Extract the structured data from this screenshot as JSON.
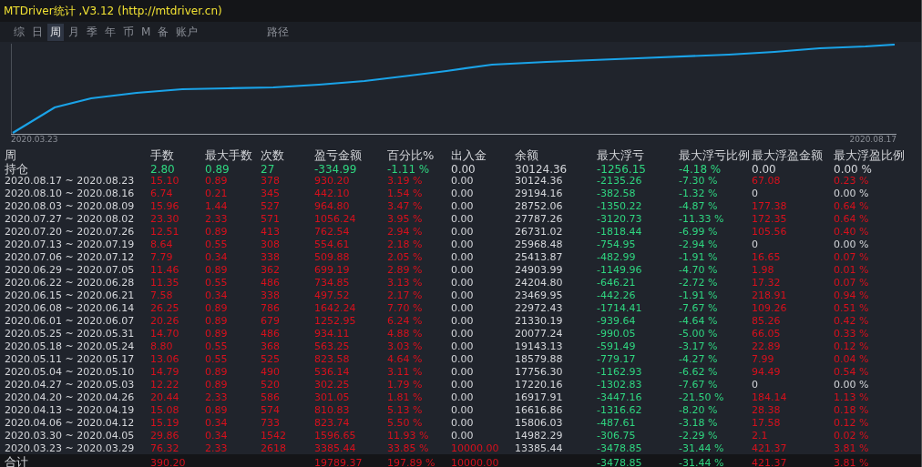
{
  "window": {
    "title": "MTDriver统计 ,V3.12 (http://mtdriver.cn)"
  },
  "tabs": [
    {
      "label": "综",
      "selected": false
    },
    {
      "label": "日",
      "selected": false
    },
    {
      "label": "周",
      "selected": true
    },
    {
      "label": "月",
      "selected": false
    },
    {
      "label": "季",
      "selected": false
    },
    {
      "label": "年",
      "selected": false
    },
    {
      "label": "币",
      "selected": false
    },
    {
      "label": "M",
      "selected": false
    },
    {
      "label": "备",
      "selected": false
    },
    {
      "label": "账户",
      "selected": false
    }
  ],
  "path_button": "路径",
  "chart": {
    "start_label": "2020.03.23",
    "end_label": "2020.08.17"
  },
  "table": {
    "columns": [
      "周",
      "手数",
      "最大手数",
      "次数",
      "盈亏金额",
      "百分比%",
      "出入金",
      "余额",
      "最大浮亏",
      "最大浮亏比例",
      "最大浮盈金额",
      "最大浮盈比例"
    ],
    "rows": [
      {
        "kind": "hold",
        "cells": [
          "持仓",
          {
            "text": "2.80",
            "color": "#2fd680"
          },
          {
            "text": "0.89",
            "color": "#2fd680"
          },
          {
            "text": "27",
            "color": "#2fd680"
          },
          {
            "text": "-334.99",
            "color": "#2fd680"
          },
          {
            "text": "-1.11 %",
            "color": "#2fd680"
          },
          "0.00",
          "30124.36",
          {
            "text": "-1256.15",
            "color": "#2fd680"
          },
          {
            "text": "-4.18 %",
            "color": "#2fd680"
          },
          "0.00",
          "0.00 %"
        ]
      },
      {
        "kind": "week",
        "cells": [
          "2020.08.17 ~ 2020.08.23",
          {
            "text": "15.10",
            "color": "#d8101c"
          },
          {
            "text": "0.89",
            "color": "#d8101c"
          },
          {
            "text": "378",
            "color": "#d8101c"
          },
          {
            "text": "930.20",
            "color": "#d8101c"
          },
          {
            "text": "3.19 %",
            "color": "#d8101c"
          },
          "0.00",
          "30124.36",
          {
            "text": "-2135.26",
            "color": "#2fd680"
          },
          {
            "text": "-7.30 %",
            "color": "#2fd680"
          },
          {
            "text": "67.08",
            "color": "#d8101c"
          },
          {
            "text": "0.23 %",
            "color": "#d8101c"
          }
        ]
      },
      {
        "kind": "week",
        "cells": [
          "2020.08.10 ~ 2020.08.16",
          {
            "text": "6.74",
            "color": "#d8101c"
          },
          {
            "text": "0.21",
            "color": "#d8101c"
          },
          {
            "text": "345",
            "color": "#d8101c"
          },
          {
            "text": "442.10",
            "color": "#d8101c"
          },
          {
            "text": "1.54 %",
            "color": "#d8101c"
          },
          "0.00",
          "29194.16",
          {
            "text": "-382.58",
            "color": "#2fd680"
          },
          {
            "text": "-1.32 %",
            "color": "#2fd680"
          },
          "0",
          "0.00 %"
        ]
      },
      {
        "kind": "week",
        "cells": [
          "2020.08.03 ~ 2020.08.09",
          {
            "text": "15.96",
            "color": "#d8101c"
          },
          {
            "text": "1.44",
            "color": "#d8101c"
          },
          {
            "text": "527",
            "color": "#d8101c"
          },
          {
            "text": "964.80",
            "color": "#d8101c"
          },
          {
            "text": "3.47 %",
            "color": "#d8101c"
          },
          "0.00",
          "28752.06",
          {
            "text": "-1350.22",
            "color": "#2fd680"
          },
          {
            "text": "-4.87 %",
            "color": "#2fd680"
          },
          {
            "text": "177.38",
            "color": "#d8101c"
          },
          {
            "text": "0.64 %",
            "color": "#d8101c"
          }
        ]
      },
      {
        "kind": "week",
        "cells": [
          "2020.07.27 ~ 2020.08.02",
          {
            "text": "23.30",
            "color": "#d8101c"
          },
          {
            "text": "2.33",
            "color": "#d8101c"
          },
          {
            "text": "571",
            "color": "#d8101c"
          },
          {
            "text": "1056.24",
            "color": "#d8101c"
          },
          {
            "text": "3.95 %",
            "color": "#d8101c"
          },
          "0.00",
          "27787.26",
          {
            "text": "-3120.73",
            "color": "#2fd680"
          },
          {
            "text": "-11.33 %",
            "color": "#2fd680"
          },
          {
            "text": "172.35",
            "color": "#d8101c"
          },
          {
            "text": "0.64 %",
            "color": "#d8101c"
          }
        ]
      },
      {
        "kind": "week",
        "cells": [
          "2020.07.20 ~ 2020.07.26",
          {
            "text": "12.51",
            "color": "#d8101c"
          },
          {
            "text": "0.89",
            "color": "#d8101c"
          },
          {
            "text": "413",
            "color": "#d8101c"
          },
          {
            "text": "762.54",
            "color": "#d8101c"
          },
          {
            "text": "2.94 %",
            "color": "#d8101c"
          },
          "0.00",
          "26731.02",
          {
            "text": "-1818.44",
            "color": "#2fd680"
          },
          {
            "text": "-6.99 %",
            "color": "#2fd680"
          },
          {
            "text": "105.56",
            "color": "#d8101c"
          },
          {
            "text": "0.40 %",
            "color": "#d8101c"
          }
        ]
      },
      {
        "kind": "week",
        "cells": [
          "2020.07.13 ~ 2020.07.19",
          {
            "text": "8.64",
            "color": "#d8101c"
          },
          {
            "text": "0.55",
            "color": "#d8101c"
          },
          {
            "text": "308",
            "color": "#d8101c"
          },
          {
            "text": "554.61",
            "color": "#d8101c"
          },
          {
            "text": "2.18 %",
            "color": "#d8101c"
          },
          "0.00",
          "25968.48",
          {
            "text": "-754.95",
            "color": "#2fd680"
          },
          {
            "text": "-2.94 %",
            "color": "#2fd680"
          },
          "0",
          "0.00 %"
        ]
      },
      {
        "kind": "week",
        "cells": [
          "2020.07.06 ~ 2020.07.12",
          {
            "text": "7.79",
            "color": "#d8101c"
          },
          {
            "text": "0.34",
            "color": "#d8101c"
          },
          {
            "text": "338",
            "color": "#d8101c"
          },
          {
            "text": "509.88",
            "color": "#d8101c"
          },
          {
            "text": "2.05 %",
            "color": "#d8101c"
          },
          "0.00",
          "25413.87",
          {
            "text": "-482.99",
            "color": "#2fd680"
          },
          {
            "text": "-1.91 %",
            "color": "#2fd680"
          },
          {
            "text": "16.65",
            "color": "#d8101c"
          },
          {
            "text": "0.07 %",
            "color": "#d8101c"
          }
        ]
      },
      {
        "kind": "week",
        "cells": [
          "2020.06.29 ~ 2020.07.05",
          {
            "text": "11.46",
            "color": "#d8101c"
          },
          {
            "text": "0.89",
            "color": "#d8101c"
          },
          {
            "text": "362",
            "color": "#d8101c"
          },
          {
            "text": "699.19",
            "color": "#d8101c"
          },
          {
            "text": "2.89 %",
            "color": "#d8101c"
          },
          "0.00",
          "24903.99",
          {
            "text": "-1149.96",
            "color": "#2fd680"
          },
          {
            "text": "-4.70 %",
            "color": "#2fd680"
          },
          {
            "text": "1.98",
            "color": "#d8101c"
          },
          {
            "text": "0.01 %",
            "color": "#d8101c"
          }
        ]
      },
      {
        "kind": "week",
        "cells": [
          "2020.06.22 ~ 2020.06.28",
          {
            "text": "11.35",
            "color": "#d8101c"
          },
          {
            "text": "0.55",
            "color": "#d8101c"
          },
          {
            "text": "486",
            "color": "#d8101c"
          },
          {
            "text": "734.85",
            "color": "#d8101c"
          },
          {
            "text": "3.13 %",
            "color": "#d8101c"
          },
          "0.00",
          "24204.80",
          {
            "text": "-646.21",
            "color": "#2fd680"
          },
          {
            "text": "-2.72 %",
            "color": "#2fd680"
          },
          {
            "text": "17.32",
            "color": "#d8101c"
          },
          {
            "text": "0.07 %",
            "color": "#d8101c"
          }
        ]
      },
      {
        "kind": "week",
        "cells": [
          "2020.06.15 ~ 2020.06.21",
          {
            "text": "7.58",
            "color": "#d8101c"
          },
          {
            "text": "0.34",
            "color": "#d8101c"
          },
          {
            "text": "338",
            "color": "#d8101c"
          },
          {
            "text": "497.52",
            "color": "#d8101c"
          },
          {
            "text": "2.17 %",
            "color": "#d8101c"
          },
          "0.00",
          "23469.95",
          {
            "text": "-442.26",
            "color": "#2fd680"
          },
          {
            "text": "-1.91 %",
            "color": "#2fd680"
          },
          {
            "text": "218.91",
            "color": "#d8101c"
          },
          {
            "text": "0.94 %",
            "color": "#d8101c"
          }
        ]
      },
      {
        "kind": "week",
        "cells": [
          "2020.06.08 ~ 2020.06.14",
          {
            "text": "26.25",
            "color": "#d8101c"
          },
          {
            "text": "0.89",
            "color": "#d8101c"
          },
          {
            "text": "786",
            "color": "#d8101c"
          },
          {
            "text": "1642.24",
            "color": "#d8101c"
          },
          {
            "text": "7.70 %",
            "color": "#d8101c"
          },
          "0.00",
          "22972.43",
          {
            "text": "-1714.41",
            "color": "#2fd680"
          },
          {
            "text": "-7.67 %",
            "color": "#2fd680"
          },
          {
            "text": "109.26",
            "color": "#d8101c"
          },
          {
            "text": "0.51 %",
            "color": "#d8101c"
          }
        ]
      },
      {
        "kind": "week",
        "cells": [
          "2020.06.01 ~ 2020.06.07",
          {
            "text": "20.26",
            "color": "#d8101c"
          },
          {
            "text": "0.89",
            "color": "#d8101c"
          },
          {
            "text": "679",
            "color": "#d8101c"
          },
          {
            "text": "1252.95",
            "color": "#d8101c"
          },
          {
            "text": "6.24 %",
            "color": "#d8101c"
          },
          "0.00",
          "21330.19",
          {
            "text": "-939.64",
            "color": "#2fd680"
          },
          {
            "text": "-4.64 %",
            "color": "#2fd680"
          },
          {
            "text": "85.26",
            "color": "#d8101c"
          },
          {
            "text": "0.42 %",
            "color": "#d8101c"
          }
        ]
      },
      {
        "kind": "week",
        "cells": [
          "2020.05.25 ~ 2020.05.31",
          {
            "text": "14.70",
            "color": "#d8101c"
          },
          {
            "text": "0.89",
            "color": "#d8101c"
          },
          {
            "text": "486",
            "color": "#d8101c"
          },
          {
            "text": "934.11",
            "color": "#d8101c"
          },
          {
            "text": "4.88 %",
            "color": "#d8101c"
          },
          "0.00",
          "20077.24",
          {
            "text": "-990.05",
            "color": "#2fd680"
          },
          {
            "text": "-5.00 %",
            "color": "#2fd680"
          },
          {
            "text": "66.05",
            "color": "#d8101c"
          },
          {
            "text": "0.33 %",
            "color": "#d8101c"
          }
        ]
      },
      {
        "kind": "week",
        "cells": [
          "2020.05.18 ~ 2020.05.24",
          {
            "text": "8.80",
            "color": "#d8101c"
          },
          {
            "text": "0.55",
            "color": "#d8101c"
          },
          {
            "text": "368",
            "color": "#d8101c"
          },
          {
            "text": "563.25",
            "color": "#d8101c"
          },
          {
            "text": "3.03 %",
            "color": "#d8101c"
          },
          "0.00",
          "19143.13",
          {
            "text": "-591.49",
            "color": "#2fd680"
          },
          {
            "text": "-3.17 %",
            "color": "#2fd680"
          },
          {
            "text": "22.89",
            "color": "#d8101c"
          },
          {
            "text": "0.12 %",
            "color": "#d8101c"
          }
        ]
      },
      {
        "kind": "week",
        "cells": [
          "2020.05.11 ~ 2020.05.17",
          {
            "text": "13.06",
            "color": "#d8101c"
          },
          {
            "text": "0.55",
            "color": "#d8101c"
          },
          {
            "text": "525",
            "color": "#d8101c"
          },
          {
            "text": "823.58",
            "color": "#d8101c"
          },
          {
            "text": "4.64 %",
            "color": "#d8101c"
          },
          "0.00",
          "18579.88",
          {
            "text": "-779.17",
            "color": "#2fd680"
          },
          {
            "text": "-4.27 %",
            "color": "#2fd680"
          },
          {
            "text": "7.99",
            "color": "#d8101c"
          },
          {
            "text": "0.04 %",
            "color": "#d8101c"
          }
        ]
      },
      {
        "kind": "week",
        "cells": [
          "2020.05.04 ~ 2020.05.10",
          {
            "text": "14.79",
            "color": "#d8101c"
          },
          {
            "text": "0.89",
            "color": "#d8101c"
          },
          {
            "text": "490",
            "color": "#d8101c"
          },
          {
            "text": "536.14",
            "color": "#d8101c"
          },
          {
            "text": "3.11 %",
            "color": "#d8101c"
          },
          "0.00",
          "17756.30",
          {
            "text": "-1162.93",
            "color": "#2fd680"
          },
          {
            "text": "-6.62 %",
            "color": "#2fd680"
          },
          {
            "text": "94.49",
            "color": "#d8101c"
          },
          {
            "text": "0.54 %",
            "color": "#d8101c"
          }
        ]
      },
      {
        "kind": "week",
        "cells": [
          "2020.04.27 ~ 2020.05.03",
          {
            "text": "12.22",
            "color": "#d8101c"
          },
          {
            "text": "0.89",
            "color": "#d8101c"
          },
          {
            "text": "520",
            "color": "#d8101c"
          },
          {
            "text": "302.25",
            "color": "#d8101c"
          },
          {
            "text": "1.79 %",
            "color": "#d8101c"
          },
          "0.00",
          "17220.16",
          {
            "text": "-1302.83",
            "color": "#2fd680"
          },
          {
            "text": "-7.67 %",
            "color": "#2fd680"
          },
          "0",
          "0.00 %"
        ]
      },
      {
        "kind": "week",
        "cells": [
          "2020.04.20 ~ 2020.04.26",
          {
            "text": "20.44",
            "color": "#d8101c"
          },
          {
            "text": "2.33",
            "color": "#d8101c"
          },
          {
            "text": "586",
            "color": "#d8101c"
          },
          {
            "text": "301.05",
            "color": "#d8101c"
          },
          {
            "text": "1.81 %",
            "color": "#d8101c"
          },
          "0.00",
          "16917.91",
          {
            "text": "-3447.16",
            "color": "#2fd680"
          },
          {
            "text": "-21.50 %",
            "color": "#2fd680"
          },
          {
            "text": "184.14",
            "color": "#d8101c"
          },
          {
            "text": "1.13 %",
            "color": "#d8101c"
          }
        ]
      },
      {
        "kind": "week",
        "cells": [
          "2020.04.13 ~ 2020.04.19",
          {
            "text": "15.08",
            "color": "#d8101c"
          },
          {
            "text": "0.89",
            "color": "#d8101c"
          },
          {
            "text": "574",
            "color": "#d8101c"
          },
          {
            "text": "810.83",
            "color": "#d8101c"
          },
          {
            "text": "5.13 %",
            "color": "#d8101c"
          },
          "0.00",
          "16616.86",
          {
            "text": "-1316.62",
            "color": "#2fd680"
          },
          {
            "text": "-8.20 %",
            "color": "#2fd680"
          },
          {
            "text": "28.38",
            "color": "#d8101c"
          },
          {
            "text": "0.18 %",
            "color": "#d8101c"
          }
        ]
      },
      {
        "kind": "week",
        "cells": [
          "2020.04.06 ~ 2020.04.12",
          {
            "text": "15.19",
            "color": "#d8101c"
          },
          {
            "text": "0.34",
            "color": "#d8101c"
          },
          {
            "text": "733",
            "color": "#d8101c"
          },
          {
            "text": "823.74",
            "color": "#d8101c"
          },
          {
            "text": "5.50 %",
            "color": "#d8101c"
          },
          "0.00",
          "15806.03",
          {
            "text": "-487.61",
            "color": "#2fd680"
          },
          {
            "text": "-3.18 %",
            "color": "#2fd680"
          },
          {
            "text": "17.58",
            "color": "#d8101c"
          },
          {
            "text": "0.12 %",
            "color": "#d8101c"
          }
        ]
      },
      {
        "kind": "week",
        "cells": [
          "2020.03.30 ~ 2020.04.05",
          {
            "text": "29.86",
            "color": "#d8101c"
          },
          {
            "text": "0.34",
            "color": "#d8101c"
          },
          {
            "text": "1542",
            "color": "#d8101c"
          },
          {
            "text": "1596.65",
            "color": "#d8101c"
          },
          {
            "text": "11.93 %",
            "color": "#d8101c"
          },
          "0.00",
          "14982.29",
          {
            "text": "-306.75",
            "color": "#2fd680"
          },
          {
            "text": "-2.29 %",
            "color": "#2fd680"
          },
          {
            "text": "2.1",
            "color": "#d8101c"
          },
          {
            "text": "0.02 %",
            "color": "#d8101c"
          }
        ]
      },
      {
        "kind": "week",
        "cells": [
          "2020.03.23 ~ 2020.03.29",
          {
            "text": "76.32",
            "color": "#d8101c"
          },
          {
            "text": "2.33",
            "color": "#d8101c"
          },
          {
            "text": "2618",
            "color": "#d8101c"
          },
          {
            "text": "3385.44",
            "color": "#d8101c"
          },
          {
            "text": "33.85 %",
            "color": "#d8101c"
          },
          {
            "text": "10000.00",
            "color": "#d8101c"
          },
          "13385.44",
          {
            "text": "-3478.85",
            "color": "#2fd680"
          },
          {
            "text": "-31.44 %",
            "color": "#2fd680"
          },
          {
            "text": "421.37",
            "color": "#d8101c"
          },
          {
            "text": "3.81 %",
            "color": "#d8101c"
          }
        ]
      },
      {
        "kind": "total",
        "cells": [
          "合计",
          {
            "text": "390.20",
            "color": "#d8101c"
          },
          null,
          null,
          {
            "text": "19789.37",
            "color": "#d8101c"
          },
          {
            "text": "197.89 %",
            "color": "#d8101c"
          },
          {
            "text": "10000.00",
            "color": "#d8101c"
          },
          null,
          {
            "text": "-3478.85",
            "color": "#2fd680"
          },
          {
            "text": "-31.44 %",
            "color": "#2fd680"
          },
          {
            "text": "421.37",
            "color": "#d8101c"
          },
          {
            "text": "3.81 %",
            "color": "#d8101c"
          }
        ]
      }
    ]
  }
}
